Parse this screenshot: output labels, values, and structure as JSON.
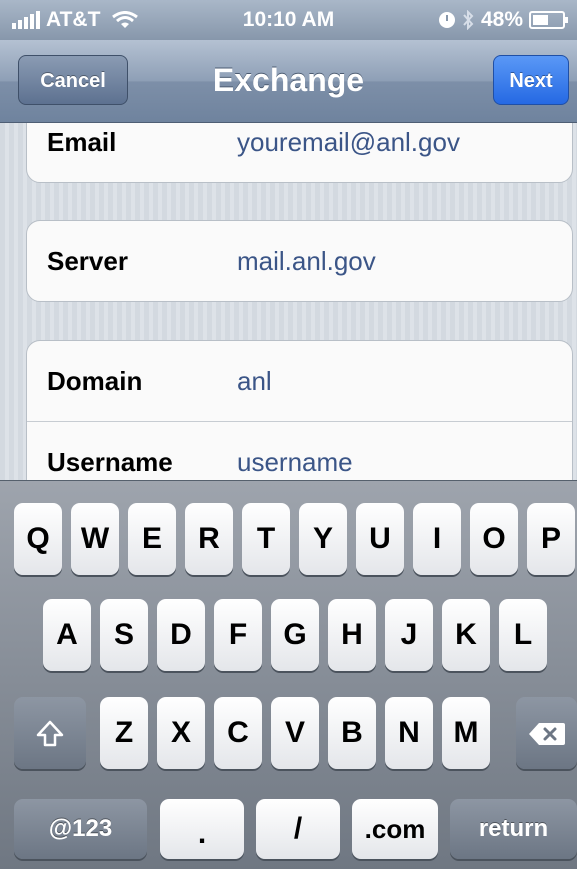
{
  "status_bar": {
    "carrier": "AT&T",
    "time": "10:10 AM",
    "battery": "48%",
    "icons": [
      "signal-icon",
      "wifi-icon",
      "alarm-icon",
      "bluetooth-icon",
      "battery-icon"
    ]
  },
  "nav": {
    "title": "Exchange",
    "cancel_label": "Cancel",
    "next_label": "Next",
    "next_color": "#2f7bf0"
  },
  "form": {
    "fields": [
      {
        "label": "Email",
        "value": "youremail@anl.gov"
      },
      {
        "label": "Server",
        "value": "mail.anl.gov"
      },
      {
        "label": "Domain",
        "value": "anl"
      },
      {
        "label": "Username",
        "value": "username"
      }
    ]
  },
  "keyboard": {
    "row1": [
      "Q",
      "W",
      "E",
      "R",
      "T",
      "Y",
      "U",
      "I",
      "O",
      "P"
    ],
    "row2": [
      "A",
      "S",
      "D",
      "F",
      "G",
      "H",
      "J",
      "K",
      "L"
    ],
    "row3": [
      "Z",
      "X",
      "C",
      "V",
      "B",
      "N",
      "M"
    ],
    "bottom": {
      "numbers_label": "@123",
      "period_label": ".",
      "slash_label": "/",
      "dotcom_label": ".com",
      "return_label": "return"
    },
    "icons": [
      "shift-icon",
      "backspace-icon"
    ]
  }
}
